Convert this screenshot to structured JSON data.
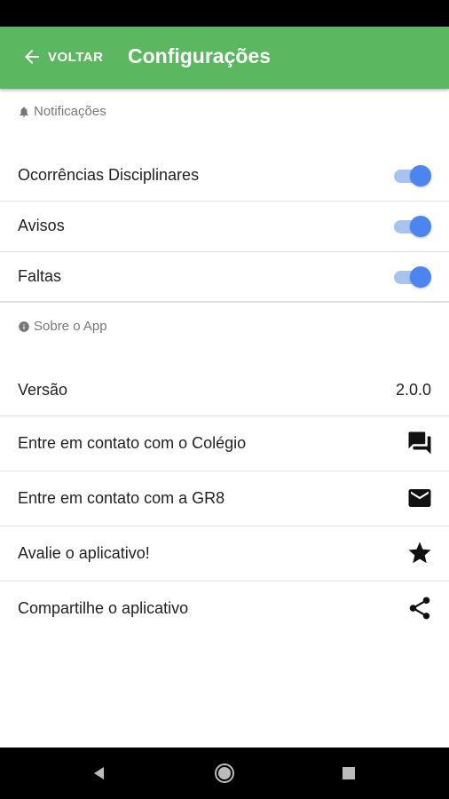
{
  "app_bar": {
    "back_label": "VOLTAR",
    "title": "Configurações",
    "color": "#5cb860"
  },
  "sections": {
    "notifications": {
      "header": "Notificações",
      "icon": "bell-icon",
      "items": [
        {
          "label": "Ocorrências Disciplinares",
          "enabled": true
        },
        {
          "label": "Avisos",
          "enabled": true
        },
        {
          "label": "Faltas",
          "enabled": true
        }
      ]
    },
    "about": {
      "header": "Sobre o App",
      "icon": "info-icon",
      "version_label": "Versão",
      "version_value": "2.0.0",
      "items": [
        {
          "label": "Entre em contato com o Colégio",
          "icon": "chat-icon"
        },
        {
          "label": "Entre em contato com a GR8",
          "icon": "mail-icon"
        },
        {
          "label": "Avalie o aplicativo!",
          "icon": "star-icon"
        },
        {
          "label": "Compartilhe o aplicativo",
          "icon": "share-icon"
        }
      ]
    }
  },
  "toggle_color": "#4c84f0",
  "nav_bar": {
    "buttons": [
      "back-icon",
      "home-icon",
      "recents-icon"
    ]
  }
}
